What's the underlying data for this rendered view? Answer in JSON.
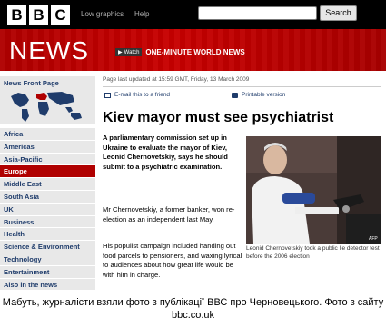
{
  "header": {
    "logo_letters": [
      "B",
      "B",
      "C"
    ],
    "links": [
      "Low graphics",
      "Help"
    ],
    "search_button": "Search"
  },
  "banner": {
    "title": "NEWS",
    "watch_badge": "Watch",
    "watch_title": "ONE-MINUTE WORLD NEWS"
  },
  "nav": {
    "top_label": "News Front Page",
    "items": [
      {
        "label": "Africa",
        "active": false
      },
      {
        "label": "Americas",
        "active": false
      },
      {
        "label": "Asia-Pacific",
        "active": false
      },
      {
        "label": "Europe",
        "active": true
      },
      {
        "label": "Middle East",
        "active": false
      },
      {
        "label": "South Asia",
        "active": false
      },
      {
        "label": "UK",
        "active": false
      },
      {
        "label": "Business",
        "active": false
      },
      {
        "label": "Health",
        "active": false
      },
      {
        "label": "Science & Environment",
        "active": false
      },
      {
        "label": "Technology",
        "active": false
      },
      {
        "label": "Entertainment",
        "active": false
      },
      {
        "label": "Also in the news",
        "active": false
      }
    ]
  },
  "article": {
    "updated": "Page last updated at 15:59 GMT, Friday, 13 March 2009",
    "email_link": "E-mail this to a friend",
    "print_link": "Printable version",
    "headline": "Kiev mayor must see psychiatrist",
    "lede": "A parliamentary commission set up in Ukraine to evaluate the mayor of Kiev, Leonid Chernovetskiy, says he should submit to a psychiatric examination.",
    "para1": "Mr Chernovetskiy, a former banker, won re-election as an independent last May.",
    "para2": "His populist campaign included handing out food parcels to pensioners, and waxing lyrical to audiences about how great life would be with him in charge.",
    "photo_caption": "Leonid Chernovetskiy took a public lie detector test before the 2006 election",
    "photo_credit": "AFP"
  },
  "outer_caption": "Мабуть, журналісти взяли фото з публікації ВВС про Черновецького. Фото з сайту bbc.co.uk",
  "colors": {
    "bbc_red": "#b00000",
    "nav_blue": "#1f3c6b",
    "nav_bg": "#e8e8e8"
  }
}
